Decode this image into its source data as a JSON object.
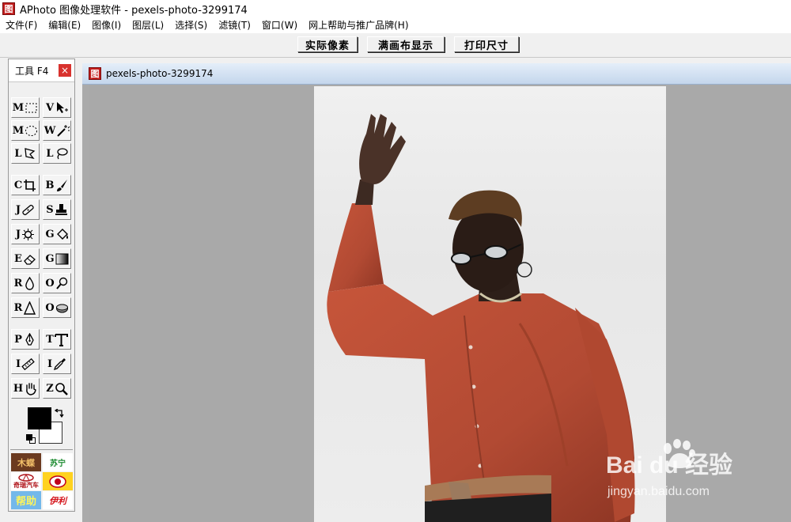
{
  "window": {
    "logo": "图",
    "title": "APhoto 图像处理软件 - pexels-photo-3299174"
  },
  "menu": [
    "文件(F)",
    "编辑(E)",
    "图像(I)",
    "图层(L)",
    "选择(S)",
    "滤镜(T)",
    "窗口(W)",
    "网上帮助与推广品牌(H)"
  ],
  "toolbar": {
    "actual_pixels": "实际像素",
    "fit_canvas": "满画布显示",
    "print_size": "打印尺寸"
  },
  "tools_panel": {
    "title": "工具 F4",
    "close": "×",
    "tools": [
      {
        "key": "M",
        "name": "rect-marquee"
      },
      {
        "key": "V",
        "name": "move"
      },
      {
        "key": "M",
        "name": "ellipse-marquee"
      },
      {
        "key": "W",
        "name": "magic-wand"
      },
      {
        "key": "L",
        "name": "polygon-lasso"
      },
      {
        "key": "L",
        "name": "lasso"
      },
      {
        "key": "C",
        "name": "crop"
      },
      {
        "key": "B",
        "name": "brush"
      },
      {
        "key": "J",
        "name": "healing-bandage"
      },
      {
        "key": "S",
        "name": "clone-stamp"
      },
      {
        "key": "J",
        "name": "spot-heal"
      },
      {
        "key": "G",
        "name": "paint-bucket"
      },
      {
        "key": "E",
        "name": "eraser"
      },
      {
        "key": "G",
        "name": "gradient"
      },
      {
        "key": "R",
        "name": "blur-drop"
      },
      {
        "key": "O",
        "name": "dodge"
      },
      {
        "key": "R",
        "name": "sharpen"
      },
      {
        "key": "O",
        "name": "burn"
      },
      {
        "key": "P",
        "name": "pen"
      },
      {
        "key": "T",
        "name": "type"
      },
      {
        "key": "I",
        "name": "ruler"
      },
      {
        "key": "I",
        "name": "eyedropper"
      },
      {
        "key": "H",
        "name": "hand"
      },
      {
        "key": "Z",
        "name": "zoom"
      }
    ]
  },
  "colors": {
    "foreground": "#000000",
    "background": "#ffffff"
  },
  "ads": [
    {
      "label": "木蝶",
      "bg": "#6b3a1f",
      "fg": "#f2c06a"
    },
    {
      "label": "苏宁",
      "bg": "#ffffff",
      "fg": "#1a8a2e"
    },
    {
      "label": "奇瑞汽车",
      "bg": "#ffffff",
      "fg": "#b0151b"
    },
    {
      "label": "",
      "bg": "#ffd21f",
      "fg": "#c0001a"
    },
    {
      "label": "帮助",
      "bg": "#73b8ea",
      "fg": "#fff45a"
    },
    {
      "label": "伊利",
      "bg": "#ffffff",
      "fg": "#d4141b"
    }
  ],
  "document": {
    "icon": "图",
    "title": "pexels-photo-3299174"
  },
  "watermark": {
    "text": "Bai du 经验",
    "url": "jingyan.baidu.com"
  }
}
